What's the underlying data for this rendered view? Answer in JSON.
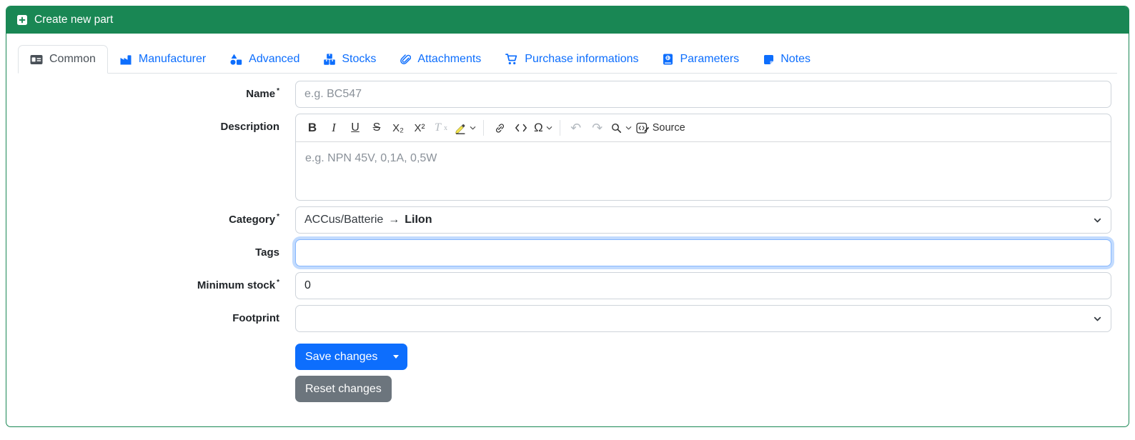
{
  "header": {
    "title": "Create new part",
    "icon": "plus-square-icon"
  },
  "tabs": [
    {
      "label": "Common",
      "icon": "id-card-icon",
      "active": true
    },
    {
      "label": "Manufacturer",
      "icon": "factory-icon",
      "active": false
    },
    {
      "label": "Advanced",
      "icon": "shapes-icon",
      "active": false
    },
    {
      "label": "Stocks",
      "icon": "boxes-icon",
      "active": false
    },
    {
      "label": "Attachments",
      "icon": "paperclip-icon",
      "active": false
    },
    {
      "label": "Purchase informations",
      "icon": "cart-icon",
      "active": false
    },
    {
      "label": "Parameters",
      "icon": "book-atlas-icon",
      "active": false
    },
    {
      "label": "Notes",
      "icon": "sticky-note-icon",
      "active": false
    }
  ],
  "form": {
    "required_marker": "*",
    "name": {
      "label": "Name",
      "required": true,
      "value": "",
      "placeholder": "e.g. BC547"
    },
    "description": {
      "label": "Description",
      "required": false,
      "value": "",
      "placeholder": "e.g. NPN 45V, 0,1A, 0,5W"
    },
    "category": {
      "label": "Category",
      "required": true,
      "value_path": "ACCus/Batterie",
      "value_arrow": "→",
      "value_selected": "LiIon"
    },
    "tags": {
      "label": "Tags",
      "value": "",
      "focused": true
    },
    "minimum_stock": {
      "label": "Minimum stock",
      "required": true,
      "value": "0"
    },
    "footprint": {
      "label": "Footprint",
      "value": ""
    }
  },
  "editor_toolbar": {
    "bold_label": "B",
    "italic_label": "I",
    "underline_label": "U",
    "strikethrough_label": "S",
    "subscript_label": "X₂",
    "superscript_label": "X²",
    "remove_format_t": "T",
    "remove_format_x": "x",
    "special_char_label": "Ω",
    "undo_label": "↶",
    "redo_label": "↷",
    "source_label": "Source"
  },
  "buttons": {
    "save_label": "Save changes",
    "reset_label": "Reset changes"
  },
  "colors": {
    "success": "#198754",
    "link": "#0d6efd",
    "secondary": "#6c757d",
    "border": "#ced4da",
    "tab_border": "#dee2e6",
    "focus": "#86b7fe"
  }
}
